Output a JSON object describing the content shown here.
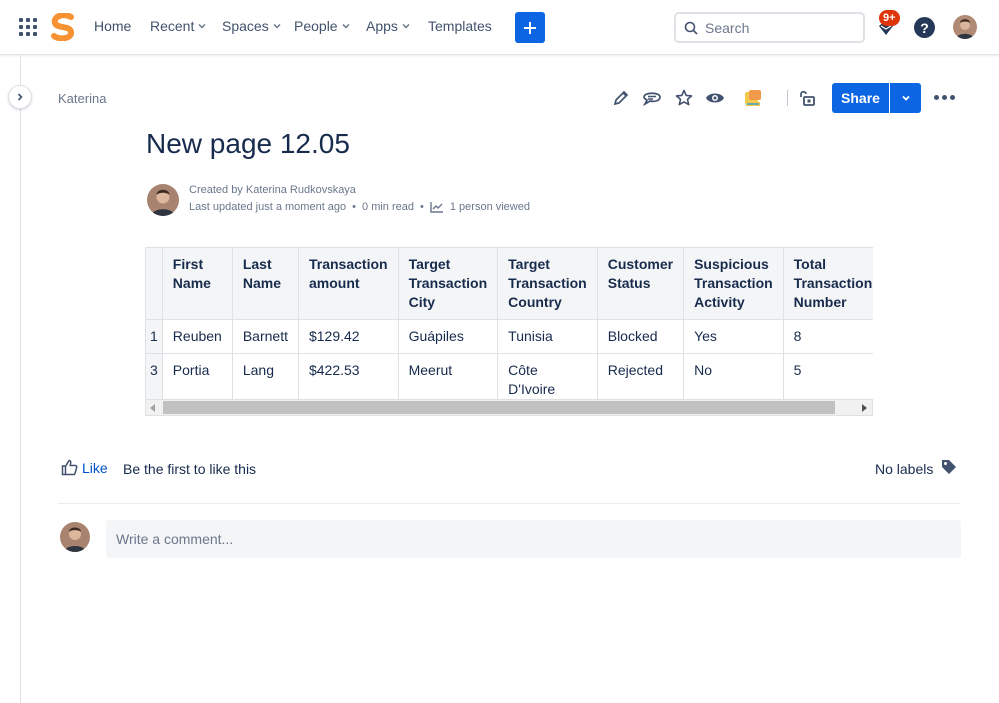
{
  "topnav": {
    "items": [
      {
        "label": "Home",
        "has_dropdown": false
      },
      {
        "label": "Recent",
        "has_dropdown": true
      },
      {
        "label": "Spaces",
        "has_dropdown": true
      },
      {
        "label": "People",
        "has_dropdown": true
      },
      {
        "label": "Apps",
        "has_dropdown": true
      },
      {
        "label": "Templates",
        "has_dropdown": false
      }
    ],
    "create_icon": "plus-icon",
    "search_placeholder": "Search",
    "notifications_badge": "9+",
    "help_label": "?"
  },
  "colors": {
    "brand_logo": "#f79232",
    "primary": "#0c66e4",
    "badge": "#de350b",
    "text": "#172b4d",
    "subtle_text": "#6b778c",
    "table_header_bg": "#f4f5f7"
  },
  "breadcrumb": "Katerina",
  "toolbar": {
    "icons": [
      "edit-icon",
      "comment-icon",
      "star-icon",
      "watch-icon",
      "app-icon",
      "restrictions-icon"
    ],
    "share_label": "Share"
  },
  "page": {
    "title": "New page 12.05",
    "created_by": "Created by Katerina Rudkovskaya",
    "last_updated": "Last updated just a moment ago",
    "read_time": "0 min read",
    "views": "1 person viewed"
  },
  "table": {
    "headers": [
      "",
      "First Name",
      "Last Name",
      "Transaction amount",
      "Target Transaction City",
      "Target Transaction Country",
      "Customer Status",
      "Suspicious Transaction Activity",
      "Total Transaction Number"
    ],
    "rows": [
      [
        "1",
        "Reuben",
        "Barnett",
        "$129.42",
        "Guápiles",
        "Tunisia",
        "Blocked",
        "Yes",
        "8"
      ],
      [
        "3",
        "Portia",
        "Lang",
        "$422.53",
        "Meerut",
        "Côte D'Ivoire (Ivory Coast)",
        "Rejected",
        "No",
        "5"
      ]
    ]
  },
  "footer": {
    "like_label": "Like",
    "like_prompt": "Be the first to like this",
    "labels_text": "No labels",
    "comment_placeholder": "Write a comment..."
  }
}
